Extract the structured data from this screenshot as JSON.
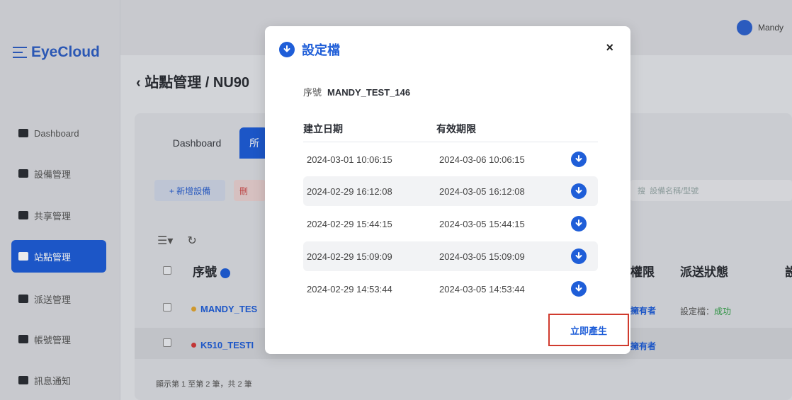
{
  "app": {
    "name": "EyeCloud"
  },
  "user": {
    "name": "Mandy"
  },
  "sidebar": {
    "items": [
      {
        "label": "Dashboard"
      },
      {
        "label": "設備管理"
      },
      {
        "label": "共享管理"
      },
      {
        "label": "站點管理"
      },
      {
        "label": "派送管理"
      },
      {
        "label": "帳號管理"
      },
      {
        "label": "訊息通知"
      }
    ]
  },
  "page": {
    "breadcrumb": "‹ 站點管理 / NU90"
  },
  "tabs": [
    {
      "label": "Dashboard"
    },
    {
      "label": "所"
    }
  ],
  "toolbar": {
    "add_label": "+ 新增設備",
    "delete_label": "刪",
    "search_label": "搜",
    "search_placeholder": "設備名稱/型號",
    "refresh": "↻"
  },
  "table": {
    "headers": {
      "serial": "序號",
      "permission": "權限",
      "status": "派送狀態",
      "extra": "設"
    },
    "rows": [
      {
        "serial": "MANDY_TES",
        "dot_color": "#e1a531",
        "permission": "擁有者",
        "status_prefix": "設定檔：",
        "status_value": "成功"
      },
      {
        "serial": "K510_TESTI",
        "dot_color": "#d33a3a",
        "permission": "擁有者"
      }
    ],
    "footer": "顯示第 1 至第 2 筆，共 2 筆"
  },
  "modal": {
    "title": "設定檔",
    "serial_label": "序號",
    "serial_value": "MANDY_TEST_146",
    "col_created": "建立日期",
    "col_expire": "有效期限",
    "rows": [
      {
        "created": "2024-03-01 10:06:15",
        "expire": "2024-03-06 10:06:15"
      },
      {
        "created": "2024-02-29 16:12:08",
        "expire": "2024-03-05 16:12:08"
      },
      {
        "created": "2024-02-29 15:44:15",
        "expire": "2024-03-05 15:44:15"
      },
      {
        "created": "2024-02-29 15:09:09",
        "expire": "2024-03-05 15:09:09"
      },
      {
        "created": "2024-02-29 14:53:44",
        "expire": "2024-03-05 14:53:44"
      }
    ],
    "generate_label": "立即產生",
    "close_symbol": "×"
  }
}
